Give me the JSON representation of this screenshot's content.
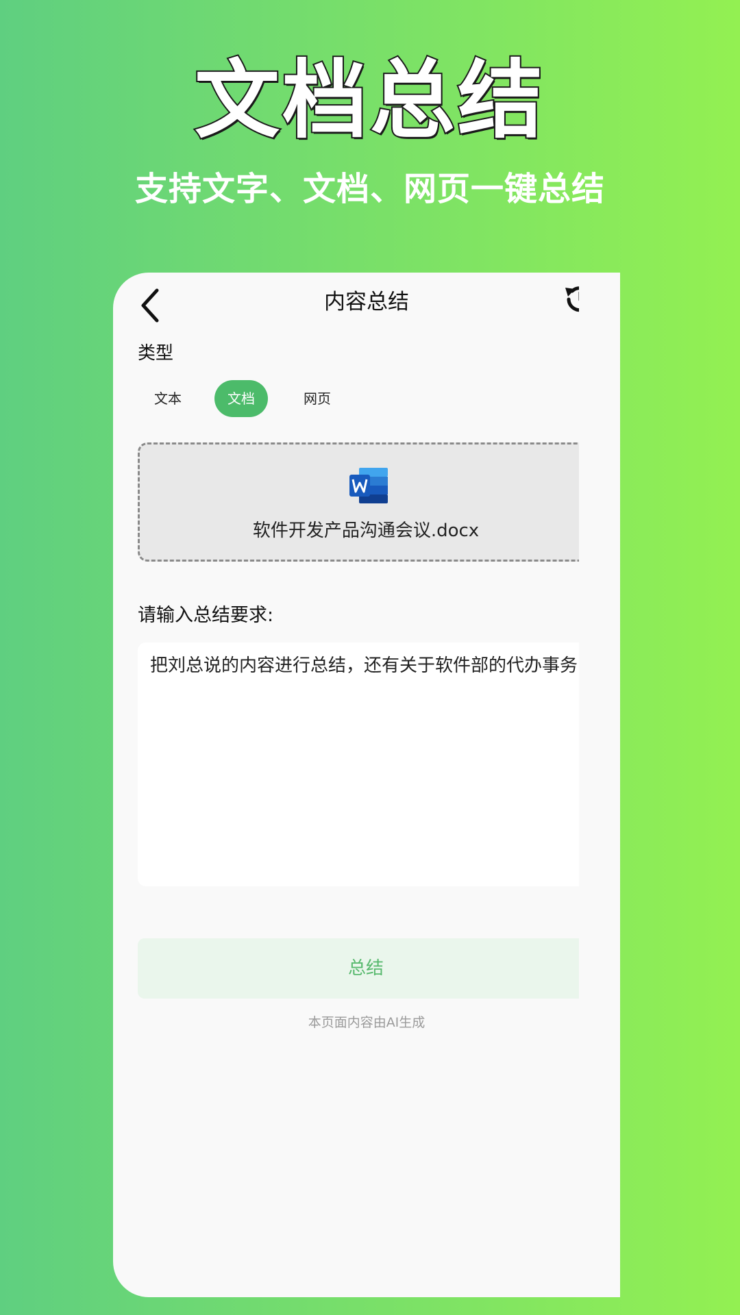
{
  "hero": {
    "title": "文档总结",
    "subtitle": "支持文字、文档、网页一键总结"
  },
  "nav": {
    "title": "内容总结",
    "back_icon": "chevron-left-icon",
    "history_icon": "history-icon"
  },
  "type": {
    "label": "类型",
    "tabs": [
      {
        "label": "文本",
        "active": false
      },
      {
        "label": "文档",
        "active": true
      },
      {
        "label": "网页",
        "active": false
      }
    ]
  },
  "upload": {
    "icon": "word-document-icon",
    "file_name": "软件开发产品沟通会议.docx"
  },
  "requirement": {
    "label": "请输入总结要求:",
    "value": "把刘总说的内容进行总结，还有关于软件部的代办事务"
  },
  "submit": {
    "label": "总结"
  },
  "footer": {
    "note": "本页面内容由AI生成"
  },
  "colors": {
    "accent": "#4cbb6a",
    "background_start": "#5fcf80",
    "background_end": "#93f052"
  }
}
